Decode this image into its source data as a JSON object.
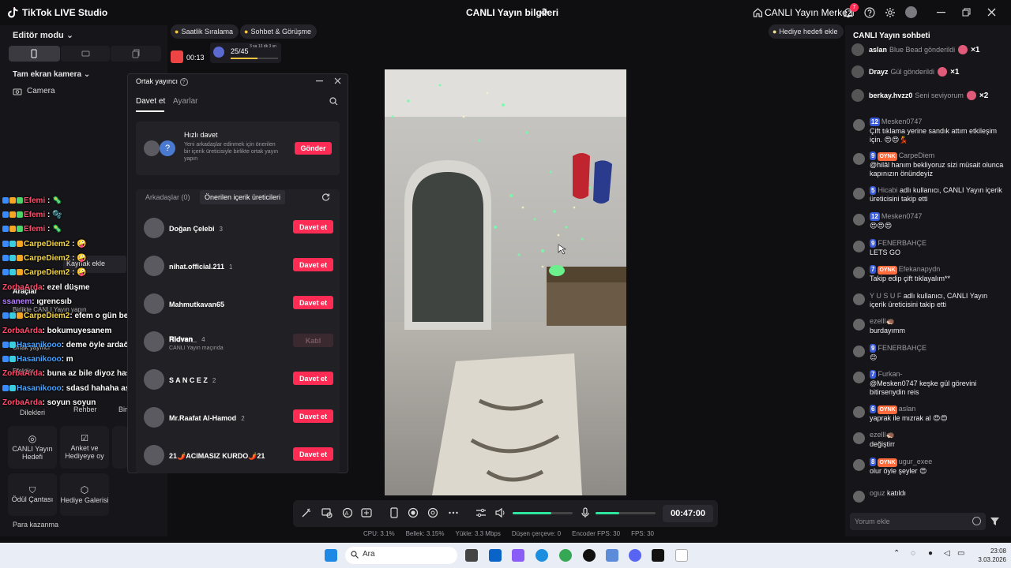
{
  "window": {
    "app_title": "TikTok LIVE Studio",
    "center_title": "CANLI Yayın bilgileri",
    "live_center": "CANLI Yayın Merkezi",
    "notification_count": "7"
  },
  "left_panel": {
    "editor_mode": "Editör modu",
    "scene_title": "Tam ekran kamera",
    "camera_source": "Camera",
    "add_source": "Kaynak ekle",
    "tools_title": "Araçlar",
    "cohost_hint": "Birlikte CANLI Yayın yapın",
    "cohost": "Ortak yayıncı",
    "effects": "Efektler",
    "wishes": "Dilekleri",
    "guide": "Rehber",
    "other": "Bir",
    "cards": [
      {
        "label": "CANLI Yayın Hedefi"
      },
      {
        "label": "Anket ve Hediyeye oy"
      },
      {
        "label": "Ödül Çantası"
      },
      {
        "label": "Hediye Galerisi"
      }
    ],
    "earn": "Para kazanma",
    "chat_overlay": [
      {
        "name": "Efemi",
        "text": ""
      },
      {
        "name": "Efemi",
        "text": ""
      },
      {
        "name": "Efemi",
        "text": ""
      },
      {
        "name": "CarpeDiem2",
        "text": ""
      },
      {
        "name": "CarpeDiem2",
        "text": ""
      },
      {
        "name": "CarpeDiem2",
        "text": ""
      },
      {
        "name": "ZorbaArda",
        "text": ": ezel düşme"
      },
      {
        "name": "ssanem",
        "text": ": ıgrencsıb"
      },
      {
        "name": "CarpeDiem2",
        "text": ": efem o gün bende varım dimi"
      },
      {
        "name": "ZorbaArda",
        "text": ": bokumuyesanem"
      },
      {
        "name": "Hasanikooo",
        "text": ": deme öyle ardaö"
      },
      {
        "name": "Hasanikooo",
        "text": ": m"
      },
      {
        "name": "ZorbaArda",
        "text": ": buna az bile diyoz hasanım hakediyo köpek"
      },
      {
        "name": "Hasanikooo",
        "text": ": sdasd hahaha aşşalıkk"
      },
      {
        "name": "ZorbaArda",
        "text": ": soyun soyun"
      }
    ]
  },
  "top_bar": {
    "hourly_rank": "Saatlik Sıralama",
    "chat_meet": "Sohbet & Görüşme",
    "timer": "00:13",
    "progress_text": "25/45",
    "progress_suffix": "3 sa 13 dk 3 sn",
    "progress_fraction": 0.56,
    "gift_goal": "Hediye hedefi ekle"
  },
  "popup": {
    "title": "Ortak yayıncı",
    "tab_invite": "Davet et",
    "tab_settings": "Ayarlar",
    "quick_title": "Hızlı davet",
    "quick_desc": "Yeni arkadaşlar edinmek için önerilen bir içerik üreticisiyle birlikte ortak yayın yapın",
    "send": "Gönder",
    "friends_tab": "Arkadaşlar (0)",
    "suggested_tab": "Önerilen içerik üreticileri",
    "invite_label": "Davet et",
    "reject_label": "Katıl",
    "users": [
      {
        "name": "Doğan Çelebi",
        "count": "3",
        "sub": "",
        "disabled": false
      },
      {
        "name": "nihat.official.211",
        "count": "1",
        "sub": "",
        "disabled": false
      },
      {
        "name": "Mahmutkavan65",
        "count": "",
        "sub": "",
        "disabled": false
      },
      {
        "name": "𝐑𝐢𝐝𝐯𝐚𝐧_",
        "count": "4",
        "sub": "CANLI Yayın maçında",
        "disabled": true
      },
      {
        "name": "S A N C E Z",
        "count": "2",
        "sub": "",
        "disabled": false
      },
      {
        "name": "Mr.Raafat Al-Hamod",
        "count": "2",
        "sub": "",
        "disabled": false
      },
      {
        "name": "21🌶️ACIMASIZ KURDO🌶️21",
        "count": "",
        "sub": "",
        "disabled": false
      }
    ]
  },
  "controls": {
    "timer": "00:47:00",
    "speaker_level": 0.65,
    "mic_level": 0.4
  },
  "status": {
    "cpu": "CPU: 3.1%",
    "memory": "Bellek: 3.15%",
    "upload": "Yükle: 3.3 Mbps",
    "dropped": "Düşen çerçeve: 0",
    "encoder_fps": "Encoder FPS: 30",
    "fps": "FPS: 30"
  },
  "chat": {
    "title": "CANLI Yayın sohbeti",
    "gifts": [
      {
        "name": "aslan",
        "text": "Blue Bead gönderildi",
        "mult": "×1"
      },
      {
        "name": "Drayz",
        "text": "Gül gönderildi",
        "mult": "×1"
      },
      {
        "name": "berkay.hvzz0",
        "text": "Seni seviyorum",
        "mult": "×2"
      }
    ],
    "messages": [
      {
        "level": "12",
        "badge": "",
        "user": "Mesken0747",
        "text": "Çift tıklama yerine sandık attım etkileşim için. 😍😍💃"
      },
      {
        "level": "9",
        "badge": "OYNK",
        "user": "CarpeDiem",
        "text": "@hilâl hanım bekliyoruz sizi müsait olunca kapınızın önündeyiz"
      },
      {
        "level": "5",
        "badge": "",
        "user": "Hicabi",
        "text": "adlı kullanıcı, CANLI Yayın içerik üreticisini takip etti"
      },
      {
        "level": "12",
        "badge": "",
        "user": "Mesken0747",
        "text": "😍😍😍"
      },
      {
        "level": "9",
        "badge": "",
        "user": "FENERBAHÇE",
        "text": "LETS GO"
      },
      {
        "level": "7",
        "badge": "OYNK",
        "user": "Efekanapydn",
        "text": "Takip edip çift tıklayalım**"
      },
      {
        "level": "",
        "badge": "",
        "user": "Y U S U F",
        "text": "adlı kullanıcı, CANLI Yayın içerik üreticisini takip etti"
      },
      {
        "level": "",
        "badge": "",
        "user": "ezelll🦔",
        "text": "burdayımm"
      },
      {
        "level": "9",
        "badge": "",
        "user": "FENERBAHÇE",
        "text": "😊"
      },
      {
        "level": "7",
        "badge": "",
        "user": "Furkan-",
        "text": "@Mesken0747 keşke gül görevini bitirsenydin reis"
      },
      {
        "level": "6",
        "badge": "OYNK",
        "user": "aslan",
        "text": "yaprak ile mızrak al 😍😍"
      },
      {
        "level": "",
        "badge": "",
        "user": "ezelll🦔",
        "text": "değiştirr"
      },
      {
        "level": "8",
        "badge": "OYNK",
        "user": "ugur_exee",
        "text": "olur öyle şeyler 😍"
      },
      {
        "level": "",
        "badge": "",
        "user": "oguz",
        "text": "katıldı"
      }
    ],
    "input_placeholder": "Yorum ekle"
  },
  "taskbar": {
    "search": "Ara",
    "time": "23:08",
    "date": "3.03.2026"
  },
  "colors": {
    "accent": "#fe2c55",
    "green": "#2ee59d",
    "bg": "#0f0f12"
  }
}
